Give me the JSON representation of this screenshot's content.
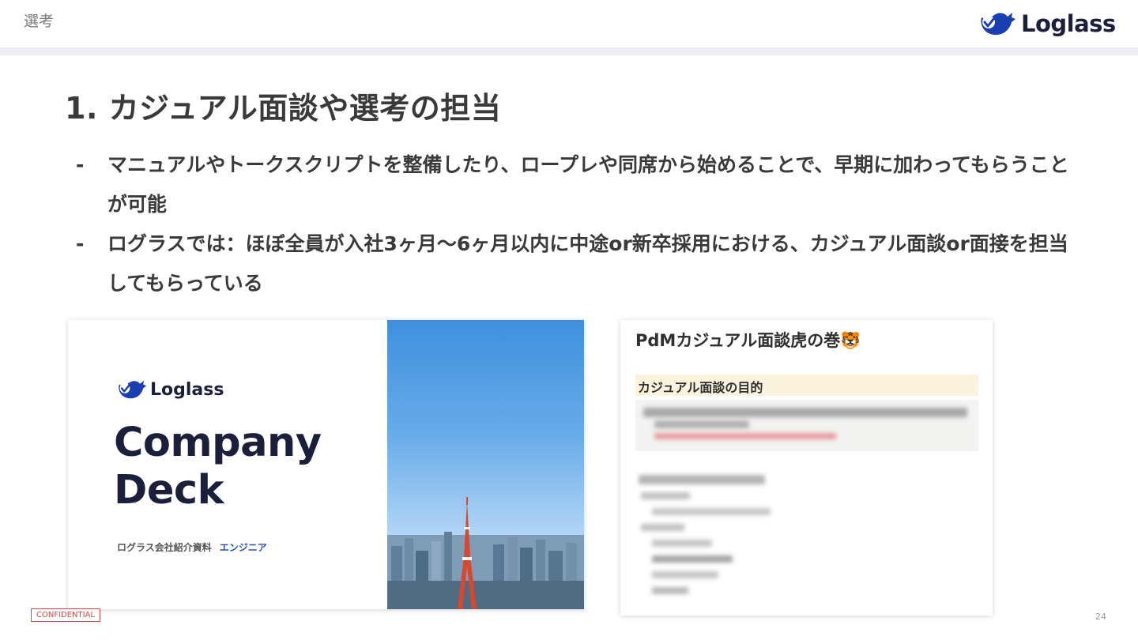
{
  "header": {
    "section_label": "選考",
    "brand_name": "Loglass",
    "brand_color": "#1a3fb0"
  },
  "slide": {
    "title": "1. カジュアル面談や選考の担当",
    "bullets": [
      {
        "marker": "-",
        "text": "マニュアルやトークスクリプトを整備したり、ロープレや同席から始めることで、早期に加わってもらうことが可能"
      },
      {
        "marker": "-",
        "text": "ログラスでは：ほぼ全員が入社3ヶ月〜6ヶ月以内に中途or新卒採用における、カジュアル面談or面接を担当してもらっている"
      }
    ]
  },
  "company_deck": {
    "brand_name": "Loglass",
    "title_line1": "Company",
    "title_line2": "Deck",
    "subtitle": "ログラス会社紹介資料",
    "subtitle_accent": "エンジニア"
  },
  "notion_doc": {
    "title": "PdMカジュアル面談虎の巻🐯",
    "callout_heading": "カジュアル面談の目的"
  },
  "footer": {
    "confidential_label": "CONFIDENTIAL",
    "page_number": "24"
  }
}
